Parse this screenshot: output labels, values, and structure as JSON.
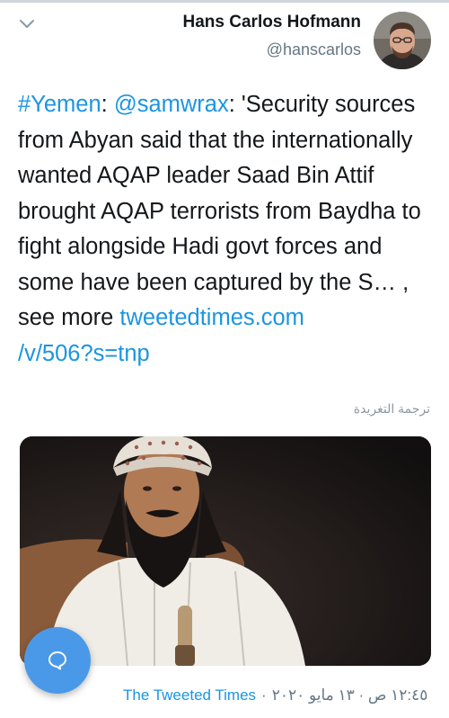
{
  "author": {
    "name": "Hans Carlos Hofmann",
    "handle": "@hanscarlos"
  },
  "tweet": {
    "hashtag": "#Yemen",
    "colon1": ": ",
    "mention": "@samwrax",
    "body": ": 'Security sources from Abyan said that the internationally wanted AQAP leader Saad Bin Attif brought AQAP terrorists from Baydha to fight alongside Hadi govt forces and some have been captured by the S… , see more ",
    "link_line1": "tweetedtimes.com",
    "link_line2": "/v/506?s=tnp"
  },
  "translate_label": "ترجمة التغريدة",
  "footer": {
    "source": "The Tweeted Times",
    "separator": "·",
    "timestamp": "١٢:٤٥ ص · ١٣ مايو ٢٠٢٠"
  },
  "colors": {
    "link": "#1b95e0",
    "fab": "#4a99e9",
    "muted": "#657786"
  },
  "icons": {
    "collapse": "chevron-down-icon",
    "compose": "reply-bubble-icon"
  }
}
